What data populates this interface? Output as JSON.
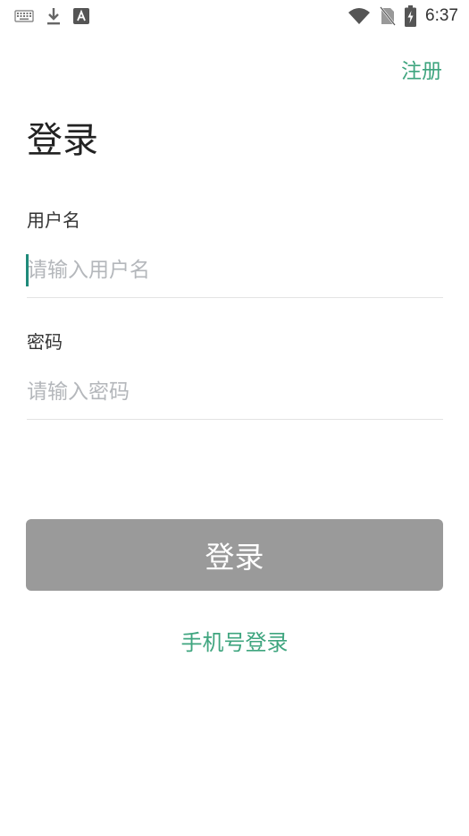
{
  "status_bar": {
    "time": "6:37",
    "icons": [
      "keyboard-icon",
      "download-icon",
      "font-a-icon",
      "wifi-icon",
      "no-sim-icon",
      "battery-charging-icon"
    ]
  },
  "header": {
    "register_label": "注册",
    "title": "登录"
  },
  "form": {
    "username": {
      "label": "用户名",
      "placeholder": "请输入用户名",
      "value": ""
    },
    "password": {
      "label": "密码",
      "placeholder": "请输入密码",
      "value": ""
    }
  },
  "actions": {
    "login_label": "登录",
    "phone_login_label": "手机号登录"
  },
  "colors": {
    "accent": "#3fa57f",
    "button_disabled": "#9a9a9a",
    "caret": "#1f8a7a"
  }
}
